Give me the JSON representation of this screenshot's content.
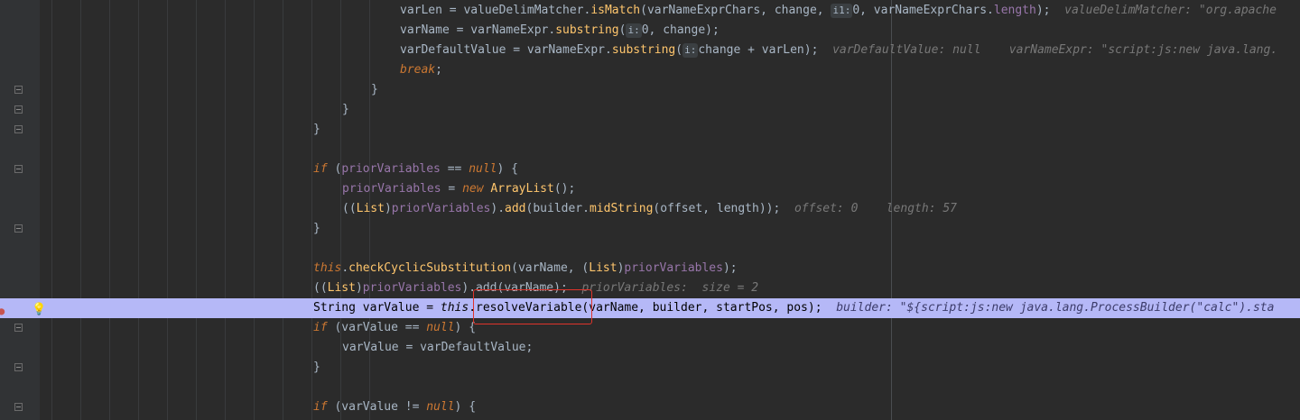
{
  "lines": {
    "l0": {
      "indent": "varLen = valueDelimMatcher.",
      "call": "isMatch",
      "args": "(varNameExprChars, change, ",
      "pname": "i1:",
      "arg2": "0, varNameExprChars.",
      "fld": "length",
      "end": ");",
      "hint": "valueDelimMatcher: \"org.apache"
    },
    "l1": {
      "a": "varName = varNameExpr.",
      "call": "substring",
      "pname": "i:",
      "rest": "0, change);"
    },
    "l2": {
      "a": "varDefaultValue = varNameExpr.",
      "call": "substring",
      "pname": "i:",
      "rest": "change + varLen);",
      "hint1": "varDefaultValue: null",
      "hint2": "varNameExpr: \"script:js:new java.lang."
    },
    "l3": {
      "kw": "break",
      "end": ";"
    },
    "l4": {
      "brace": "}"
    },
    "l5": {
      "brace": "}"
    },
    "l6": {
      "brace": "}"
    },
    "l8": {
      "kw": "if",
      "a": " (",
      "fld": "priorVariables",
      "b": " == ",
      "kw2": "null",
      "c": ") {"
    },
    "l9": {
      "fld": "priorVariables",
      "a": " = ",
      "kw": "new",
      "cls": " ArrayList",
      "b": "();"
    },
    "l10": {
      "a": "((",
      "cls": "List",
      "b": ")",
      "fld": "priorVariables",
      "c": ").",
      "fn1": "add",
      "d": "(builder.",
      "fn2": "midString",
      "e": "(offset, length));",
      "hint1": "offset: 0",
      "hint2": "length: 57"
    },
    "l11": {
      "brace": "}"
    },
    "l13": {
      "kw": "this",
      "a": ".",
      "fn": "checkCyclicSubstitution",
      "b": "(varName, (",
      "cls": "List",
      "c": ")",
      "fld": "priorVariables",
      "d": ");"
    },
    "l14": {
      "a": "((",
      "cls": "List",
      "b": ")",
      "fld": "priorVariables",
      "c": ").add(varName);",
      "hint": "priorVariables:  size = 2"
    },
    "l15": {
      "a": "String varValue = ",
      "kw": "this",
      "b": ".resolveVariable(varName, builder, startPos, pos);",
      "hint": "builder: \"${script:js:new java.lang.ProcessBuilder(\"calc\").sta"
    },
    "l16": {
      "kw": "if",
      "a": " (varValue == ",
      "kw2": "null",
      "b": ") {"
    },
    "l17": {
      "a": "varValue = varDefaultValue;"
    },
    "l18": {
      "brace": "}"
    },
    "l20": {
      "kw": "if",
      "a": " (varValue != ",
      "kw2": "null",
      "b": ") {"
    }
  },
  "colors": {
    "background": "#2b2b2b",
    "highlight": "#b5b8f7",
    "keyword": "#cc7832",
    "field": "#9876aa",
    "method": "#ffc66d",
    "annotation_box": "#e0342b"
  },
  "icons": {
    "breakpoint": "breakpoint-icon",
    "intention": "lightbulb-icon",
    "fold": "fold-marker-icon"
  }
}
